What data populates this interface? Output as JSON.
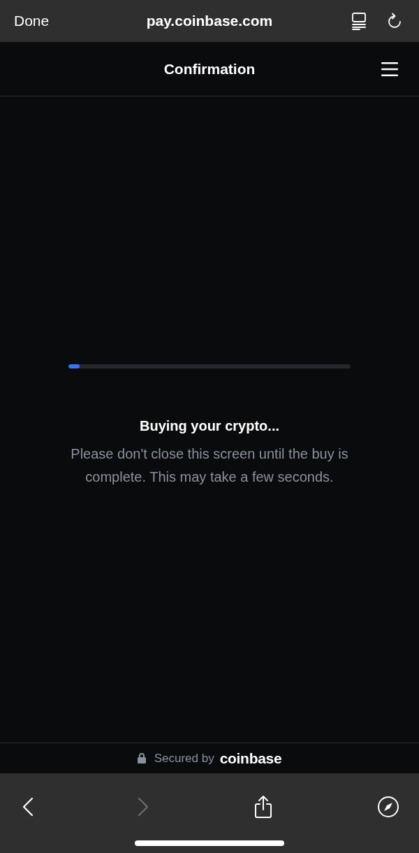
{
  "browser": {
    "done": "Done",
    "url": "pay.coinbase.com"
  },
  "header": {
    "title": "Confirmation"
  },
  "progress": {
    "level": 0.04
  },
  "status": {
    "title": "Buying your crypto...",
    "message": "Please don't close this screen until the buy is complete. This may take a few seconds."
  },
  "footer": {
    "secured_by": "Secured by",
    "brand": "coinbase"
  },
  "toolbar": {
    "buttons": [
      {
        "kind": "back",
        "disabled": false
      },
      {
        "kind": "forward",
        "disabled": true
      },
      {
        "kind": "share",
        "disabled": false
      },
      {
        "kind": "compass",
        "disabled": false
      }
    ]
  }
}
